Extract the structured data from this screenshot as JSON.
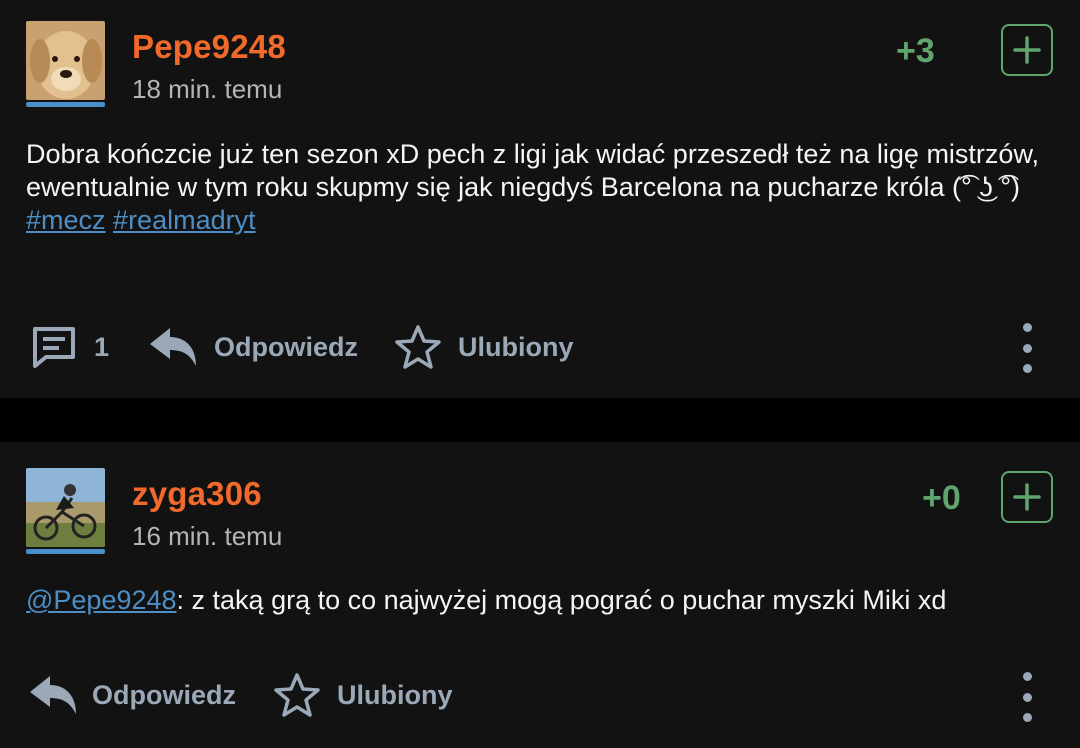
{
  "posts": [
    {
      "username": "Pepe9248",
      "time": "18 min. temu",
      "score": "+3",
      "body": "Dobra kończcie już ten sezon xD pech z ligi jak widać przeszedł też na ligę mistrzów, ewentualnie w tym roku skupmy się jak niegdyś Barcelona na pucharze króla (͡° ͜ʖ ͡°)",
      "tags": [
        "#mecz",
        "#realmadryt"
      ],
      "comment_count": "1",
      "reply_label": "Odpowiedz",
      "favorite_label": "Ulubiony"
    },
    {
      "username": "zyga306",
      "time": "16 min. temu",
      "score": "+0",
      "mention": "@Pepe9248",
      "body": ": z taką grą to co najwyżej mogą pograć o puchar myszki Miki xd",
      "reply_label": "Odpowiedz",
      "favorite_label": "Ulubiony"
    }
  ],
  "icons": {
    "comment": "comment-icon",
    "reply": "reply-arrow-icon",
    "favorite": "star-icon",
    "more": "more-vertical-icon",
    "vote": "plus-icon"
  },
  "colors": {
    "username": "#f26a2b",
    "score": "#5fa56d",
    "link": "#4e8ec4",
    "action": "#9aa8b8",
    "card_bg": "#121212"
  }
}
